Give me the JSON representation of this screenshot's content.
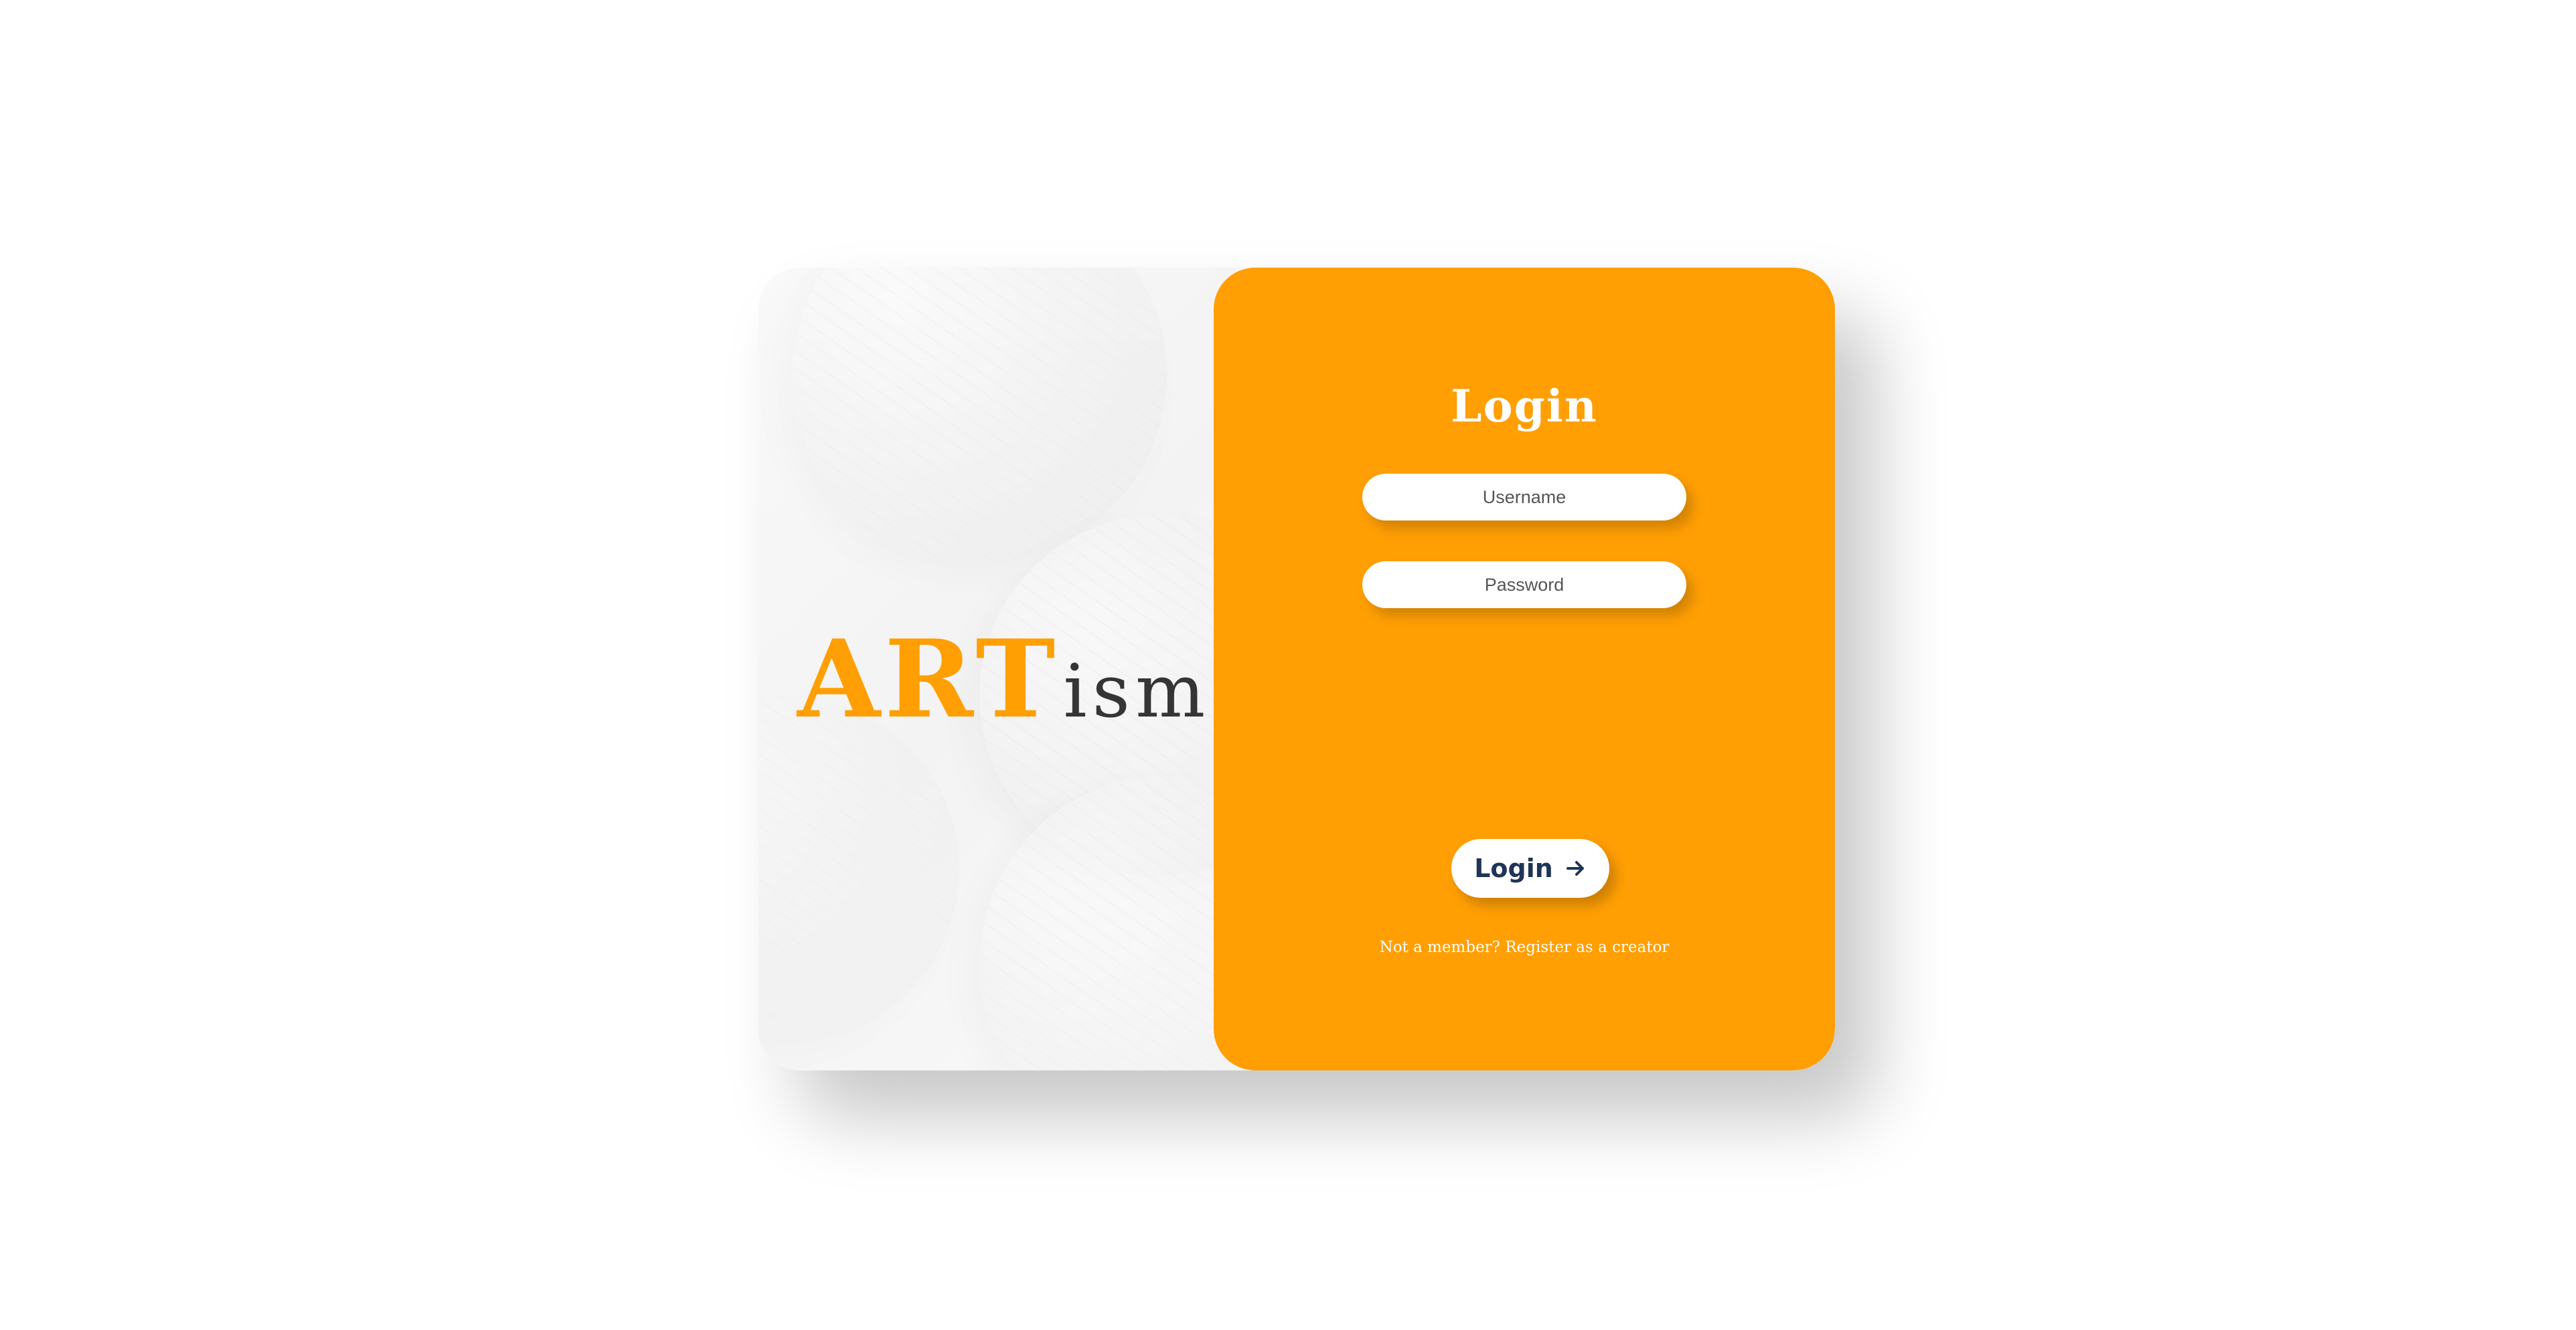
{
  "brand": {
    "art": "ART",
    "ism": "ism."
  },
  "login": {
    "title": "Login",
    "username_placeholder": "Username",
    "password_placeholder": "Password",
    "button_label": "Login",
    "button_icon": "arrow-right-icon",
    "register_text": "Not a member? Register as a creator"
  },
  "colors": {
    "accent": "#ff9f04",
    "brand_dark": "#353535",
    "button_text": "#1f3557",
    "panel_light": "#f7f7f7"
  }
}
